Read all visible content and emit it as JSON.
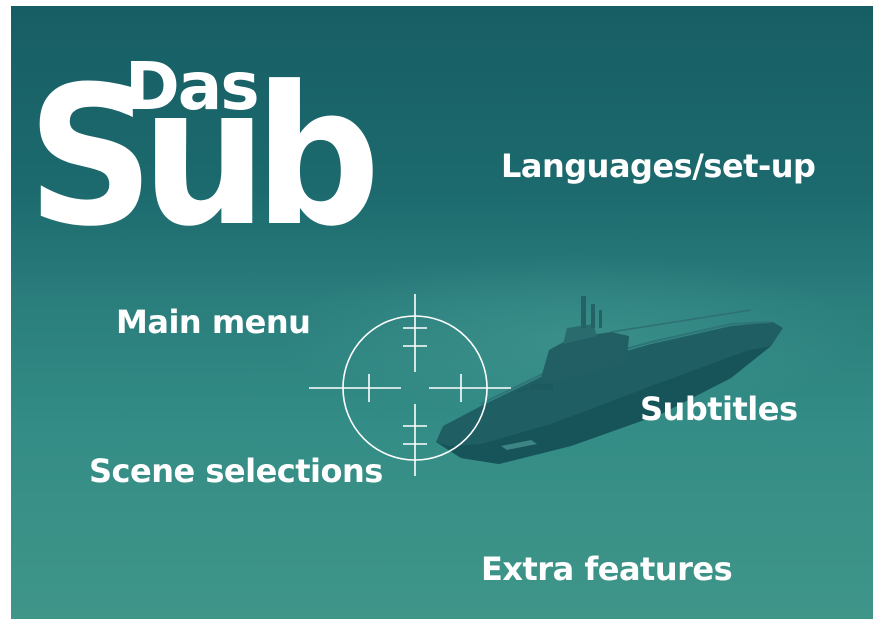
{
  "logo": {
    "top_word": "Das",
    "main_word": "Sub"
  },
  "menu": {
    "languages_setup": "Languages/set-up",
    "main_menu": "Main menu",
    "subtitles": "Subtitles",
    "scene_selections": "Scene selections",
    "extra_features": "Extra features"
  },
  "colors": {
    "background_top": "#175e64",
    "background_bottom": "#3f9588",
    "submarine": "#1f5f64",
    "text": "#ffffff"
  },
  "icons": [
    "crosshair-icon",
    "submarine-illustration"
  ]
}
